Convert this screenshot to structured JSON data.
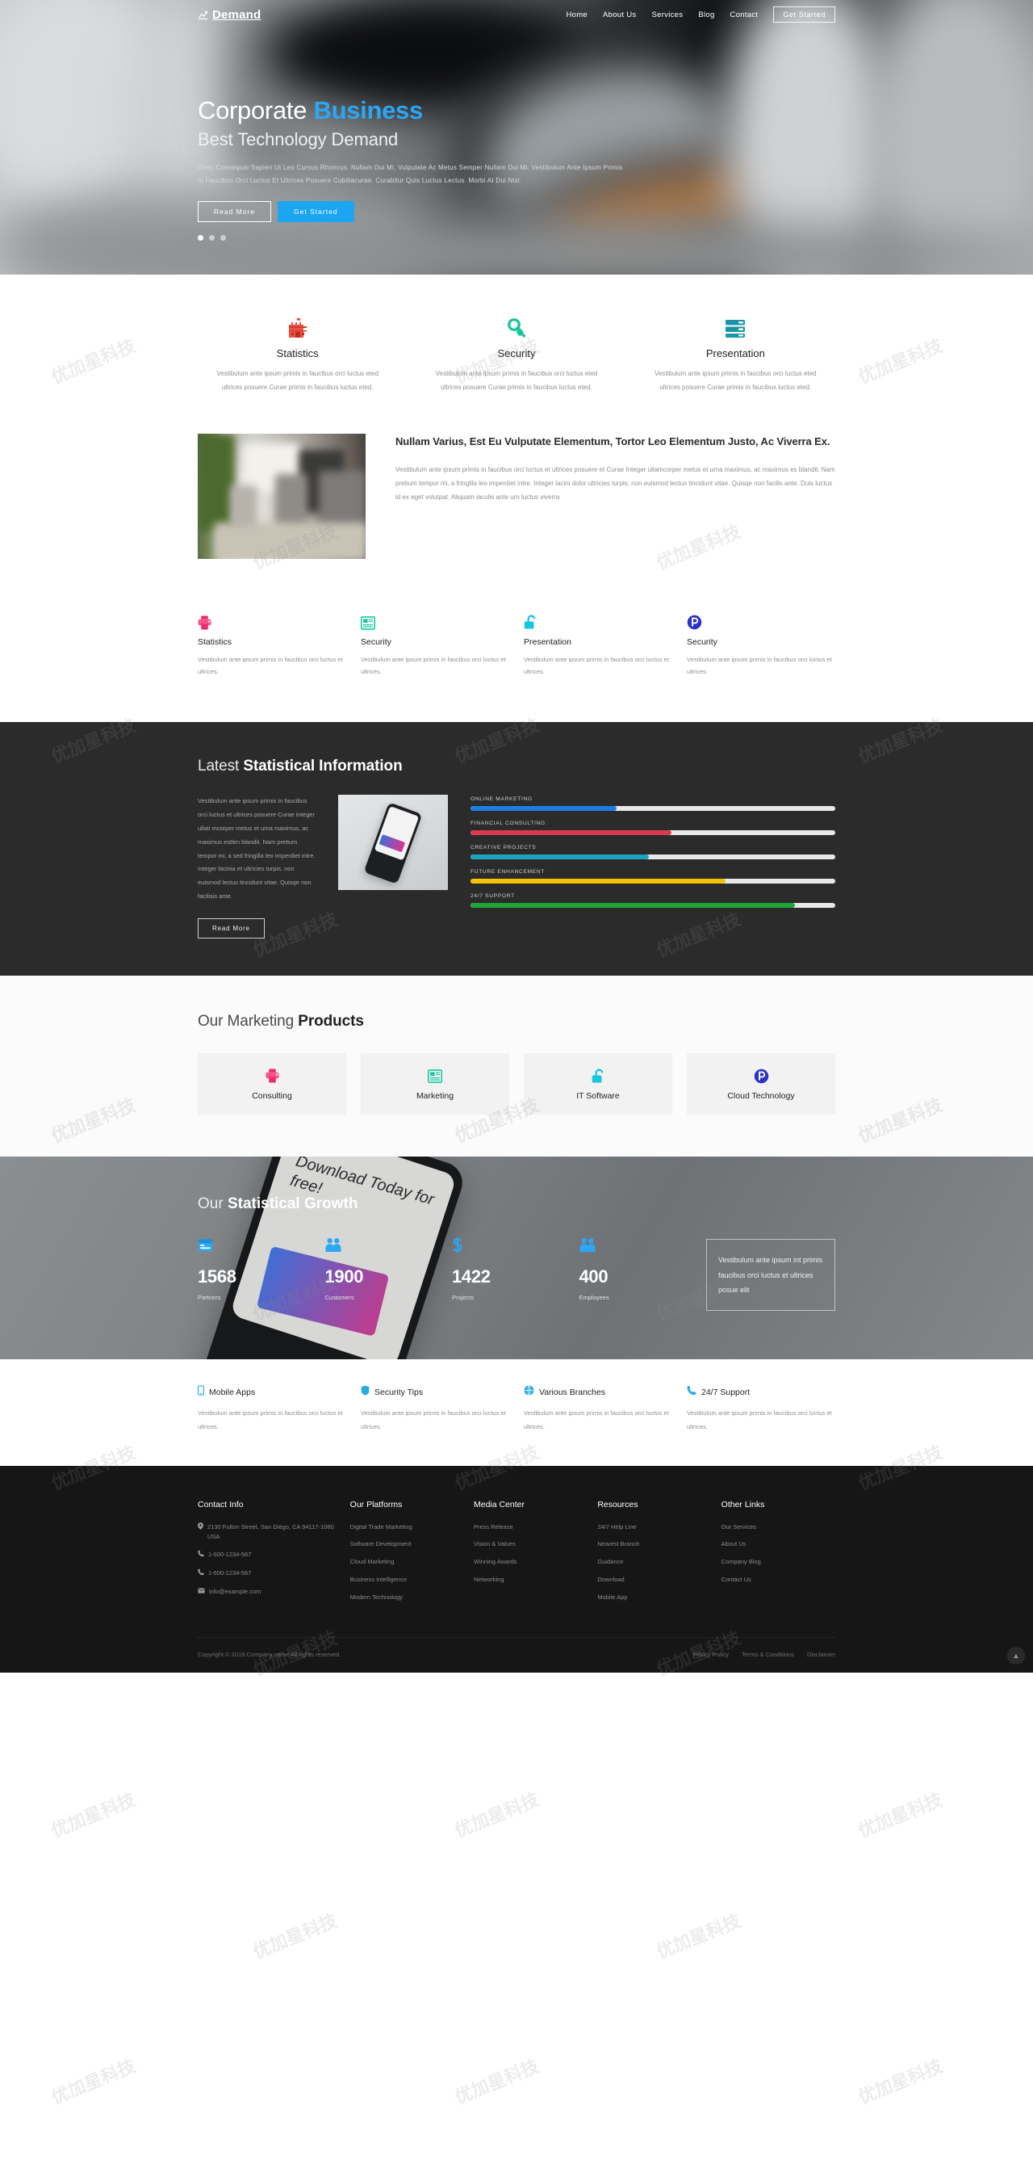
{
  "brand": {
    "name": "Demand",
    "icon": "chart-line-icon"
  },
  "nav": {
    "items": [
      {
        "label": "Home"
      },
      {
        "label": "About Us"
      },
      {
        "label": "Services"
      },
      {
        "label": "Blog"
      },
      {
        "label": "Contact"
      }
    ],
    "cta": "Get Started"
  },
  "hero": {
    "title_1": "Corporate",
    "title_accent": "Business",
    "subtitle": "Best Technology Demand",
    "paragraph": "Onec Consequat Sapien Ut Leo Cursus Rhoncus. Nullam Dui Mi, Vulputate Ac Metus Semper Nullam Dui Mi. Vestibulum Ante Ipsum Primis In Faucibus Orci Luctus Et Ultrices Posuere Cubiliacurae. Curabitur Quis Luctus Lectus. Morbi At Dui Nisl.",
    "btn_primary": "Read More",
    "btn_secondary": "Get Started",
    "slide_count": 3,
    "active_slide": 1
  },
  "features3": {
    "items": [
      {
        "icon": "castle-icon",
        "color": "#e8442f",
        "title": "Statistics",
        "text": "Vestibulum ante ipsum primis in faucibus orci luctus eted ultrices posuere Curae primis in faucibus luctus eted."
      },
      {
        "icon": "key-icon",
        "color": "#18c39a",
        "title": "Security",
        "text": "Vestibulum ante ipsum primis in faucibus orci luctus eted ultrices posuere Curae primis in faucibus luctus eted."
      },
      {
        "icon": "server-icon",
        "color": "#1c94a8",
        "title": "Presentation",
        "text": "Vestibulum ante ipsum primis in faucibus orci luctus eted ultrices posuere Curae primis in faucibus luctus eted."
      }
    ]
  },
  "about": {
    "heading": "Nullam Varius, Est Eu Vulputate Elementum, Tortor Leo Elementum Justo, Ac Viverra Ex.",
    "paragraph": "Vestibulum ante ipsum primis in faucibus orci luctus et ultrices posuere et Curae Integer ullamcorper metus et urna maximus, ac maximus es blandit. Nam pretium tempor mi, a fringilla leo imperdiet intre. Integer lacini dolor ultricies turpis: non euismod lectus tincidunt vitae. Quisqe non facilis ante. Duis luctus id ex eget volutpat. Aliquam iaculis ante urn luctus viverra"
  },
  "features4": {
    "items": [
      {
        "icon": "printer-icon",
        "color": "#ee2a6c",
        "title": "Statistics",
        "text": "Vestibulum ante ipsum primis in faucibus orci luctus et ultrices."
      },
      {
        "icon": "newspaper-icon",
        "color": "#18c9a0",
        "title": "Security",
        "text": "Vestibulum ante ipsum primis in faucibus orci luctus et ultrices."
      },
      {
        "icon": "unlock-icon",
        "color": "#16c7dd",
        "title": "Presentation",
        "text": "Vestibulum ante ipsum primis in faucibus orci luctus et ultrices."
      },
      {
        "icon": "parking-icon",
        "color": "#2b32c7",
        "title": "Security",
        "text": "Vestibulum ante ipsum primis in faucibus orci luctus et ultrices."
      }
    ]
  },
  "stats_section": {
    "heading_light": "Latest ",
    "heading_bold": "Statistical Information",
    "paragraph": "Vestibulum ante ipsum primis in faucibus orci luctus et ultrices posuere Curae Integer ullati mcorper metus et urna maximus, ac maximus estlen blandit. Nam pretium tempor mi, a sed fringilla leo imperdiet intre. Integer lacinia et ultricies turpis. non euismod lectus tincidunt vitae. Quisqe non facilisis ante.",
    "button": "Read More",
    "image_alt": "smartphone-photo"
  },
  "chart_data": {
    "type": "bar",
    "title": "Latest Statistical Information",
    "orientation": "horizontal",
    "categories": [
      "ONLINE MARKETING",
      "FINANCIAL CONSULTING",
      "CREATIVE PROJECTS",
      "FUTURE ENHANCEMENT",
      "24/7 SUPPORT"
    ],
    "values": [
      40,
      55,
      49,
      70,
      89
    ],
    "colors": [
      "#1b7ee0",
      "#d93a4c",
      "#1ba5bf",
      "#f5c400",
      "#1fa637"
    ],
    "ylim": [
      0,
      100
    ],
    "xlabel": "",
    "ylabel": "",
    "grid": false,
    "legend": "none"
  },
  "products": {
    "heading_light": "Our Marketing ",
    "heading_bold": "Products",
    "items": [
      {
        "icon": "printer-icon",
        "color": "#ee2a6c",
        "title": "Consulting"
      },
      {
        "icon": "newspaper-icon",
        "color": "#18c9a0",
        "title": "Marketing"
      },
      {
        "icon": "unlock-icon",
        "color": "#16c7dd",
        "title": "IT Software"
      },
      {
        "icon": "parking-icon",
        "color": "#2b32c7",
        "title": "Cloud Technology"
      }
    ]
  },
  "growth": {
    "heading_light": "Our ",
    "heading_bold": "Statistical Growth",
    "counters": [
      {
        "icon": "calendar-icon",
        "value": "1568",
        "label": "Partners"
      },
      {
        "icon": "users-icon",
        "value": "1900",
        "label": "Customers"
      },
      {
        "icon": "dollar-icon",
        "value": "1422",
        "label": "Projects"
      },
      {
        "icon": "users-icon",
        "value": "400",
        "label": "Employees"
      }
    ],
    "quote": "Vestibulum ante ipsum int primis faucibus orci luctus et ultrices posue elit",
    "phone_overlay_text": "Download Today for free!"
  },
  "services4": {
    "items": [
      {
        "icon": "mobile-icon",
        "title": "Mobile Apps",
        "text": "Vestibulum ante ipsum primis in faucibus orci luctus et ultrices."
      },
      {
        "icon": "shield-icon",
        "title": "Security Tips",
        "text": "Vestibulum ante ipsum primis in faucibus orci luctus et ultrices."
      },
      {
        "icon": "globe-icon",
        "title": "Various Branches",
        "text": "Vestibulum ante ipsum primis in faucibus orci luctus et ultrices."
      },
      {
        "icon": "phone-icon",
        "title": "24/7 Support",
        "text": "Vestibulum ante ipsum primis in faucibus orci luctus et ultrices."
      }
    ]
  },
  "footer": {
    "contact": {
      "title": "Contact Info",
      "address": "2130 Fulton Street, San Diego, CA 94117-1080 USA",
      "phone1": "1-600-1234-567",
      "phone2": "1-600-1234-567",
      "email": "info@example.com"
    },
    "platforms": {
      "title": "Our Platforms",
      "links": [
        "Digital Trade Marketing",
        "Software Development",
        "Cloud Marketing",
        "Business Intelligence",
        "Modern Technology"
      ]
    },
    "media": {
      "title": "Media Center",
      "links": [
        "Press Release",
        "Vision & Values",
        "Winning Awards",
        "Networking"
      ]
    },
    "resources": {
      "title": "Resources",
      "links": [
        "24/7 Help Line",
        "Nearest Branch",
        "Guidance",
        "Download",
        "Mobile App"
      ]
    },
    "other": {
      "title": "Other Links",
      "links": [
        "Our Services",
        "About Us",
        "Company Blog",
        "Contact Us"
      ]
    },
    "copyright": "Copyright © 2019.Company name All rights reserved.",
    "legal": [
      "Privicy Policy",
      "Terms & Conditions",
      "Disclaimer"
    ],
    "to_top_icon": "chevron-up-icon"
  },
  "watermark": "优加星科技"
}
